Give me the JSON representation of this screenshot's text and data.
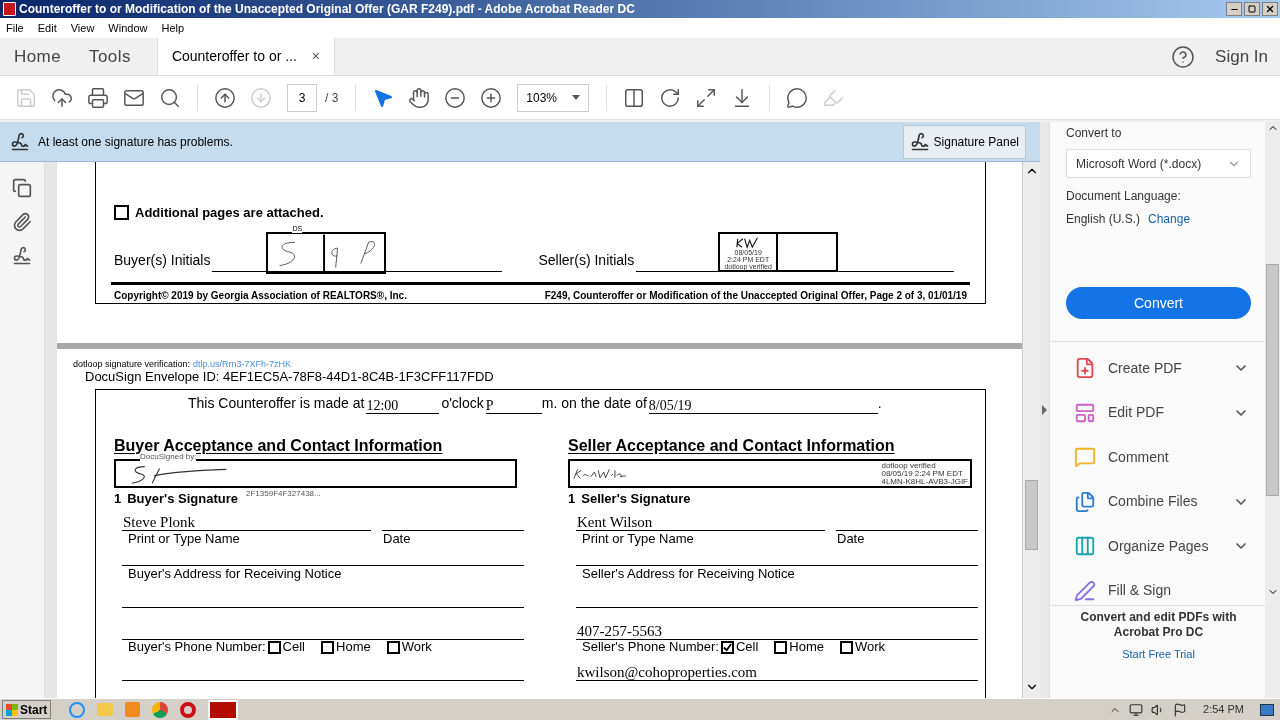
{
  "window": {
    "title": "Counteroffer to or Modification of the Unaccepted Original Offer (GAR F249).pdf - Adobe Acrobat Reader DC"
  },
  "menu": [
    "File",
    "Edit",
    "View",
    "Window",
    "Help"
  ],
  "nav": [
    {
      "label": "Home",
      "selected": false
    },
    {
      "label": "Tools",
      "selected": false
    }
  ],
  "doc_tab": {
    "label": "Counteroffer to or ...",
    "close": "×",
    "selected": true
  },
  "account": {
    "sign_in": "Sign In"
  },
  "toolbar": {
    "page": "3",
    "pages": "/ 3",
    "zoom": "103%",
    "groups": [
      [
        {
          "kind": "save",
          "disabled": true,
          "selected": false
        },
        {
          "kind": "upload",
          "disabled": false,
          "selected": false
        },
        {
          "kind": "print",
          "disabled": false,
          "selected": false
        },
        {
          "kind": "mail",
          "disabled": false,
          "selected": false
        },
        {
          "kind": "search",
          "disabled": false,
          "selected": false
        }
      ],
      [
        {
          "kind": "prev",
          "disabled": false,
          "selected": false
        },
        {
          "kind": "next",
          "disabled": true,
          "selected": false
        }
      ],
      [
        {
          "kind": "pointer",
          "disabled": false,
          "selected": true
        },
        {
          "kind": "hand",
          "disabled": false,
          "selected": false
        },
        {
          "kind": "zoom_out",
          "disabled": false,
          "selected": false
        },
        {
          "kind": "zoom_in",
          "disabled": false,
          "selected": false
        }
      ],
      [
        {
          "kind": "fit",
          "disabled": false,
          "selected": false
        },
        {
          "kind": "rotate",
          "disabled": false,
          "selected": false
        },
        {
          "kind": "fullscreen",
          "disabled": false,
          "selected": false
        },
        {
          "kind": "scroll",
          "disabled": false,
          "selected": false
        }
      ],
      [
        {
          "kind": "comment",
          "disabled": false,
          "selected": false
        },
        {
          "kind": "highlight",
          "disabled": true,
          "selected": false
        }
      ]
    ]
  },
  "signature_banner": {
    "message": "At least one signature has problems.",
    "button": "Signature Panel"
  },
  "page_prev": {
    "attached": {
      "label": "Additional pages are attached.",
      "checked": false
    },
    "buyer_initials": "Buyer(s) Initials",
    "buyer_stamp": "DS",
    "seller_initials": "Seller(s) Initials",
    "seller_stamp": [
      "08/05/19",
      "2:24 PM EDT",
      "dotloop verified"
    ],
    "footer_left": "Copyright© 2019 by Georgia Association of REALTORS®, Inc.",
    "footer_right": "F249, Counteroffer or Modification of the Unaccepted Original Offer, Page 2 of 3, 01/01/19"
  },
  "page_current": {
    "verification": {
      "label": "dotloop signature verification:",
      "link": "dtlp.us/Rrn3-7XFh-7zHK"
    },
    "envelope": "DocuSign Envelope ID: 4EF1EC5A-78F8-44D1-8C4B-1F3CFF117FDD",
    "made_at": {
      "lead": "This Counteroffer is made at",
      "time": "12:00",
      "oclock": "o'clock",
      "ampm": "P",
      "date_label": "m. on the date of",
      "date": "8/05/19",
      "end": "."
    },
    "parties": [
      {
        "kind": "docusign",
        "heading": "Buyer Acceptance and Contact Information",
        "stamp_top": "DocuSigned by:",
        "stamp_bottom": "2F1359F4F327438...",
        "number": "1",
        "signature_label": "Buyer's Signature",
        "name": "Steve Plonk",
        "name_label": "Print or Type Name",
        "date_label": "Date",
        "address_label": "Buyer's Address for Receiving Notice",
        "phone_label": "Buyer's Phone Number:",
        "phone_options": [
          {
            "label": "Cell",
            "checked": false
          },
          {
            "label": "Home",
            "checked": false
          },
          {
            "label": "Work",
            "checked": false
          }
        ]
      },
      {
        "kind": "dotloop",
        "heading": "Seller Acceptance and Contact Information",
        "stamp_lines": [
          "dotloop verified",
          "08/05/19 2:24 PM EDT",
          "4LMN-K8HL-AVB3-JGIF"
        ],
        "number": "1",
        "signature_label": "Seller's Signature",
        "name": "Kent Wilson",
        "name_label": "Print or Type Name",
        "date_label": "Date",
        "address_label": "Seller's Address for Receiving Notice",
        "phone": "407-257-5563",
        "phone_label": "Seller's Phone Number:",
        "phone_options": [
          {
            "label": "Cell",
            "checked": true
          },
          {
            "label": "Home",
            "checked": false
          },
          {
            "label": "Work",
            "checked": false
          }
        ],
        "email": "kwilson@cohoproperties.com"
      }
    ]
  },
  "right_panel": {
    "convert_label": "Convert to",
    "format": "Microsoft Word (*.docx)",
    "language_label": "Document Language:",
    "language": "English (U.S.)",
    "change": "Change",
    "convert": "Convert",
    "tools": [
      {
        "kind": "create",
        "label": "Create PDF",
        "expandable": true
      },
      {
        "kind": "edit",
        "label": "Edit PDF",
        "expandable": true
      },
      {
        "kind": "comment",
        "label": "Comment",
        "expandable": false
      },
      {
        "kind": "combine",
        "label": "Combine Files",
        "expandable": true
      },
      {
        "kind": "organize",
        "label": "Organize Pages",
        "expandable": true
      },
      {
        "kind": "sign",
        "label": "Fill & Sign",
        "expandable": false
      }
    ],
    "promo": "Convert and edit PDFs with Acrobat Pro DC",
    "trial": "Start Free Trial"
  },
  "taskbar": {
    "start": "Start",
    "time": "2:54 PM"
  }
}
